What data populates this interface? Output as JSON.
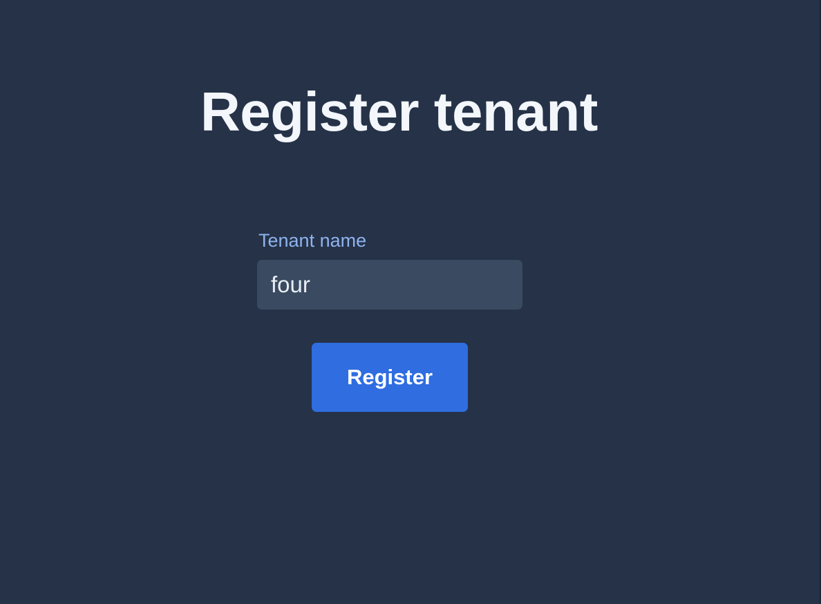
{
  "page": {
    "title": "Register tenant"
  },
  "form": {
    "tenant_name_label": "Tenant name",
    "tenant_name_value": "four",
    "submit_label": "Register"
  },
  "colors": {
    "background": "#253247",
    "title_text": "#f3f6fb",
    "label_text": "#8fb3ef",
    "input_background": "#3a4a60",
    "button_background": "#2f6de0"
  }
}
